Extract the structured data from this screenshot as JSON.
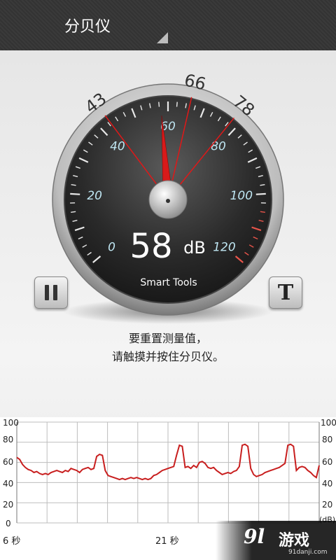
{
  "titlebar": {
    "title": "分贝仪"
  },
  "gauge": {
    "reading": "58",
    "unit": "dB",
    "brand": "Smart Tools",
    "dial_labels": [
      "0",
      "20",
      "40",
      "60",
      "80",
      "100",
      "120"
    ],
    "min_marker": "43",
    "avg_marker": "66",
    "max_marker": "78",
    "needle_value": 58,
    "min_value": 43,
    "avg_value": 66,
    "max_value": 78,
    "needle_color": "#d81a1a"
  },
  "controls": {
    "pause_icon": "pause-icon",
    "text_icon": "t-icon"
  },
  "message": {
    "line1": "要重置测量值，",
    "line2": "请触摸并按住分贝仪。"
  },
  "graph": {
    "y_ticks": [
      "100",
      "80",
      "60",
      "40",
      "20",
      "0"
    ],
    "unit_label": "(dB)",
    "x_labels": [
      "6 秒",
      "21 秒"
    ],
    "line_color": "#c81e1e",
    "chart_data": {
      "type": "line",
      "ylim": [
        0,
        100
      ],
      "values": [
        65,
        63,
        58,
        55,
        53,
        52,
        50,
        51,
        49,
        48,
        49,
        48,
        50,
        51,
        52,
        51,
        50,
        52,
        51,
        54,
        53,
        52,
        50,
        53,
        54,
        55,
        53,
        54,
        66,
        68,
        67,
        52,
        47,
        46,
        45,
        44,
        43,
        44,
        43,
        44,
        45,
        44,
        45,
        44,
        43,
        44,
        43,
        44,
        47,
        48,
        50,
        52,
        53,
        54,
        55,
        56,
        67,
        77,
        76,
        55,
        56,
        54,
        57,
        55,
        60,
        61,
        59,
        55,
        54,
        55,
        52,
        50,
        48,
        49,
        50,
        49,
        51,
        52,
        56,
        77,
        78,
        76,
        54,
        48,
        46,
        47,
        48,
        50,
        51,
        52,
        53,
        54,
        55,
        57,
        59,
        77,
        78,
        76,
        52,
        55,
        56,
        55,
        52,
        50,
        47,
        45,
        57
      ]
    }
  },
  "watermark": {
    "num": "9l",
    "text": "游戏",
    "url": "91danji.com"
  }
}
